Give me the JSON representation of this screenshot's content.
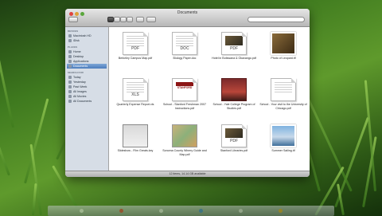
{
  "window": {
    "title": "Documents"
  },
  "sidebar": {
    "sections": [
      {
        "heading": "DEVICES",
        "items": [
          {
            "label": "Macintosh HD",
            "icon": "hard-drive-icon",
            "selected": false
          },
          {
            "label": "iDisk",
            "icon": "idisk-icon",
            "selected": false
          }
        ]
      },
      {
        "heading": "PLACES",
        "items": [
          {
            "label": "Home",
            "icon": "home-icon",
            "selected": false
          },
          {
            "label": "Desktop",
            "icon": "desktop-icon",
            "selected": false
          },
          {
            "label": "Applications",
            "icon": "applications-icon",
            "selected": false
          },
          {
            "label": "Documents",
            "icon": "documents-icon",
            "selected": true
          }
        ]
      },
      {
        "heading": "SEARCH FOR",
        "items": [
          {
            "label": "Today",
            "icon": "clock-icon",
            "selected": false
          },
          {
            "label": "Yesterday",
            "icon": "clock-icon",
            "selected": false
          },
          {
            "label": "Past Week",
            "icon": "clock-icon",
            "selected": false
          },
          {
            "label": "All Images",
            "icon": "smart-folder-icon",
            "selected": false
          },
          {
            "label": "All Movies",
            "icon": "smart-folder-icon",
            "selected": false
          },
          {
            "label": "All Documents",
            "icon": "smart-folder-icon",
            "selected": false
          }
        ]
      }
    ]
  },
  "files": [
    {
      "name": "Berkeley Campus Map.pdf",
      "kind": "doc",
      "badge": "PDF"
    },
    {
      "name": "Biology Paper.doc",
      "kind": "doc",
      "badge": "DOC"
    },
    {
      "name": "Hotel in Botswana & Okavango.pdf",
      "kind": "photo-doc",
      "badge": "PDF"
    },
    {
      "name": "Photo of Leopard.tif",
      "kind": "photo",
      "badge": ""
    },
    {
      "name": "Quarterly Expense Report.xls",
      "kind": "doc",
      "badge": "XLS"
    },
    {
      "name": "School - Stanford Freshman 2007 Instructions.pdf",
      "kind": "stanford",
      "badge": "STANFORD"
    },
    {
      "name": "School - Yale College Program of Studies.pdf",
      "kind": "book",
      "badge": ""
    },
    {
      "name": "School - Your visit to the University of Chicago.pdf",
      "kind": "doc",
      "badge": ""
    },
    {
      "name": "Slideshow - Film Greats.key",
      "kind": "keynote",
      "badge": ""
    },
    {
      "name": "Sonoma County Winery Guide and Map.pdf",
      "kind": "map",
      "badge": ""
    },
    {
      "name": "Stanford Libraries.pdf",
      "kind": "photo-doc",
      "badge": "PDF"
    },
    {
      "name": "Summer Sailing.tif",
      "kind": "sail",
      "badge": ""
    }
  ],
  "status": {
    "text": "12 items, 14.14 GB available"
  },
  "colors": {
    "sidebar_selection": "#4c7dbd",
    "stanford_red": "#8c1515"
  }
}
